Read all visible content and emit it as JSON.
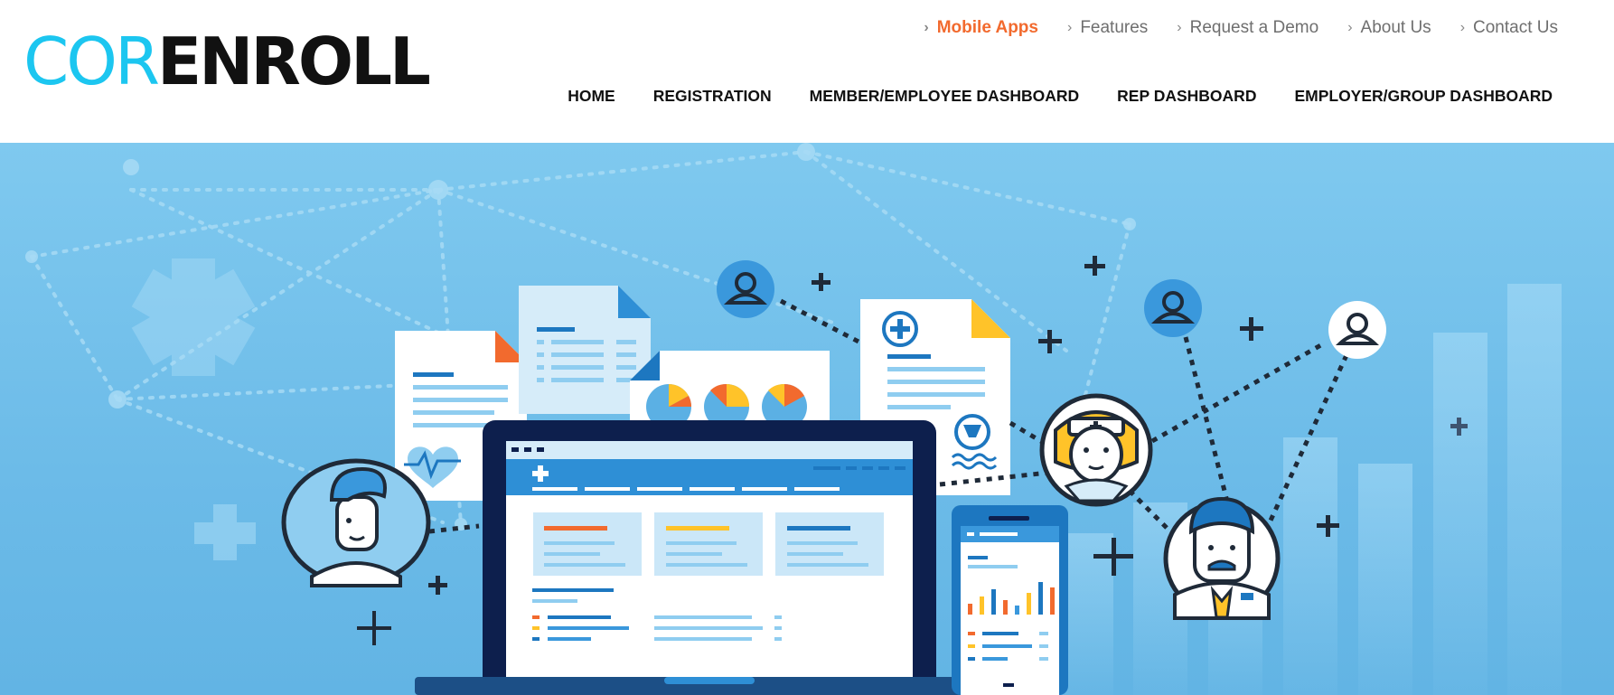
{
  "logo": {
    "part1": "COR",
    "part2": "ENROLL"
  },
  "topnav": [
    {
      "label": "Mobile Apps",
      "active": true
    },
    {
      "label": "Features"
    },
    {
      "label": "Request a Demo"
    },
    {
      "label": "About Us"
    },
    {
      "label": "Contact Us"
    }
  ],
  "mainnav": [
    {
      "label": "HOME"
    },
    {
      "label": "REGISTRATION"
    },
    {
      "label": "MEMBER/EMPLOYEE DASHBOARD"
    },
    {
      "label": "REP DASHBOARD"
    },
    {
      "label": "EMPLOYER/GROUP DASHBOARD"
    }
  ],
  "colors": {
    "accent": "#f26a2e",
    "logo_blue": "#1cc6f0",
    "hero_bg": "#6cbbe8",
    "dark_navy": "#0f2a52"
  },
  "hero": {
    "illustration": "healthcare-network-illustration",
    "icons": [
      "laptop-dashboard-icon",
      "phone-chart-icon",
      "heartbeat-document-icon",
      "pie-chart-document-icon",
      "medical-document-icon",
      "nurse-avatar-icon",
      "doctor-avatar-icon",
      "man-avatar-icon",
      "user-icon",
      "plus-icon"
    ]
  }
}
